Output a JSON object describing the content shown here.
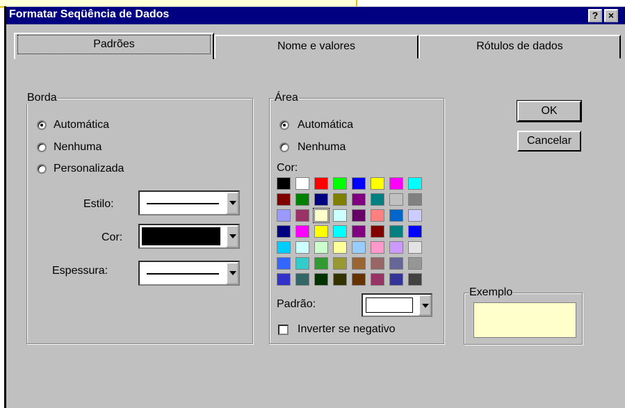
{
  "window": {
    "title": "Formatar Seqüência de Dados",
    "help_glyph": "?",
    "close_glyph": "×"
  },
  "tabs": [
    {
      "label": "Padrões",
      "active": true
    },
    {
      "label": "Nome e valores",
      "active": false
    },
    {
      "label": "Rótulos de dados",
      "active": false
    }
  ],
  "borda": {
    "legend": "Borda",
    "options": [
      {
        "label": "Automática",
        "selected": true
      },
      {
        "label": "Nenhuma",
        "selected": false
      },
      {
        "label": "Personalizada",
        "selected": false
      }
    ],
    "estilo_label": "Estilo:",
    "cor_label": "Cor:",
    "espessura_label": "Espessura:",
    "cor_value": "#000000"
  },
  "area": {
    "legend": "Área",
    "options": [
      {
        "label": "Automática",
        "selected": true
      },
      {
        "label": "Nenhuma",
        "selected": false
      }
    ],
    "cor_label": "Cor:",
    "palette": [
      [
        "#000000",
        "#ffffff",
        "#ff0000",
        "#00ff00",
        "#0000ff",
        "#ffff00",
        "#ff00ff",
        "#00ffff"
      ],
      [
        "#800000",
        "#008000",
        "#000080",
        "#808000",
        "#800080",
        "#008080",
        "#c0c0c0",
        "#808080"
      ],
      [
        "#9999ff",
        "#993366",
        "#ffffcc",
        "#ccffff",
        "#660066",
        "#ff8080",
        "#0066cc",
        "#ccccff"
      ],
      [
        "#000080",
        "#ff00ff",
        "#ffff00",
        "#00ffff",
        "#800080",
        "#800000",
        "#008080",
        "#0000ff"
      ],
      [
        "#00ccff",
        "#ccffff",
        "#ccffcc",
        "#ffff99",
        "#99ccff",
        "#ff99cc",
        "#cc99ff",
        "#e3e3e3"
      ],
      [
        "#3366ff",
        "#33cccc",
        "#339933",
        "#999933",
        "#996633",
        "#996666",
        "#666699",
        "#969696"
      ],
      [
        "#3333cc",
        "#336666",
        "#003300",
        "#333300",
        "#663300",
        "#993366",
        "#333399",
        "#424242"
      ]
    ],
    "selected_color": "#ffffcc",
    "padrao_label": "Padrão:",
    "inverter_label": "Inverter se negativo",
    "inverter_checked": false
  },
  "buttons": {
    "ok": "OK",
    "cancel": "Cancelar"
  },
  "exemplo": {
    "legend": "Exemplo",
    "color": "#ffffcc"
  }
}
